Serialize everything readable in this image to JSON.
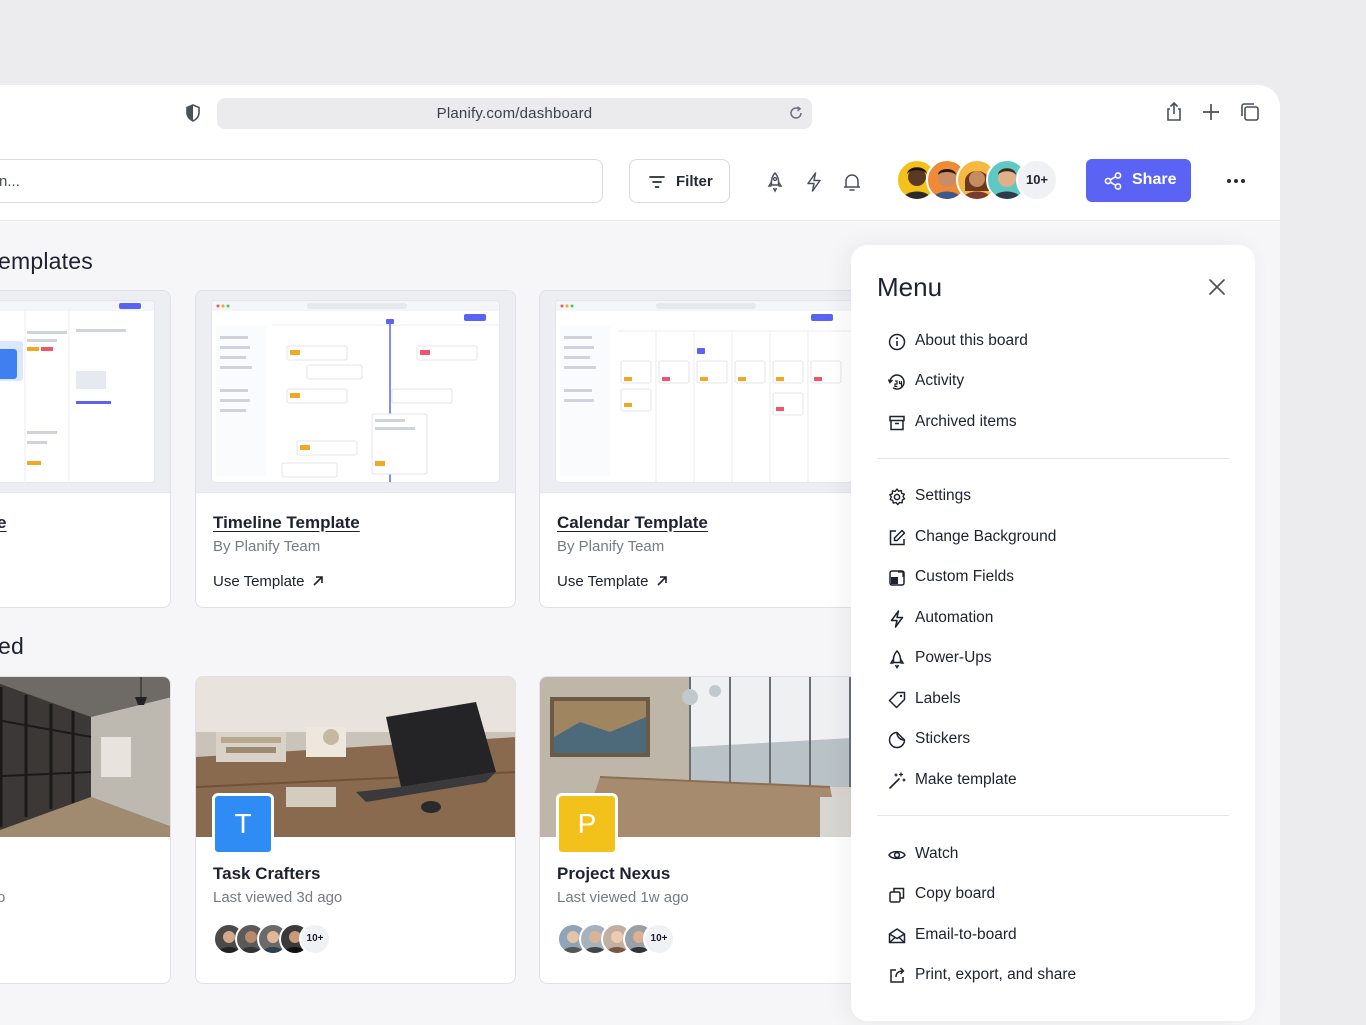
{
  "browser": {
    "url": "Planify.com/dashboard"
  },
  "toolbar": {
    "search_value": "n...",
    "filter_label": "Filter",
    "avatar_count": "10+",
    "share_label": "Share"
  },
  "sections": {
    "templates_title": "emplates",
    "recent_title": "ed"
  },
  "templates": [
    {
      "title": "e",
      "subtitle": "",
      "link": ""
    },
    {
      "title": "Timeline Template",
      "subtitle": "By Planify Team",
      "link": "Use Template"
    },
    {
      "title": "Calendar Template",
      "subtitle": "By Planify Team",
      "link": "Use Template"
    }
  ],
  "recent": [
    {
      "title": "",
      "subtitle": "o",
      "badge": "",
      "badge_color": ""
    },
    {
      "title": "Task Crafters",
      "subtitle": "Last viewed 3d ago",
      "badge": "T",
      "badge_color": "#2f8cf5",
      "avatar_count": "10+"
    },
    {
      "title": "Project Nexus",
      "subtitle": "Last viewed 1w ago",
      "badge": "P",
      "badge_color": "#f2c21b",
      "avatar_count": "10+"
    }
  ],
  "menu": {
    "title": "Menu",
    "group1": [
      "About this board",
      "Activity",
      "Archived items"
    ],
    "group2": [
      "Settings",
      "Change Background",
      "Custom Fields",
      "Automation",
      "Power-Ups",
      "Labels",
      "Stickers",
      "Make template"
    ],
    "group3": [
      "Watch",
      "Copy board",
      "Email-to-board",
      "Print, export, and share"
    ]
  },
  "colors": {
    "accent": "#5b63f5",
    "background": "#f6f6f8"
  }
}
